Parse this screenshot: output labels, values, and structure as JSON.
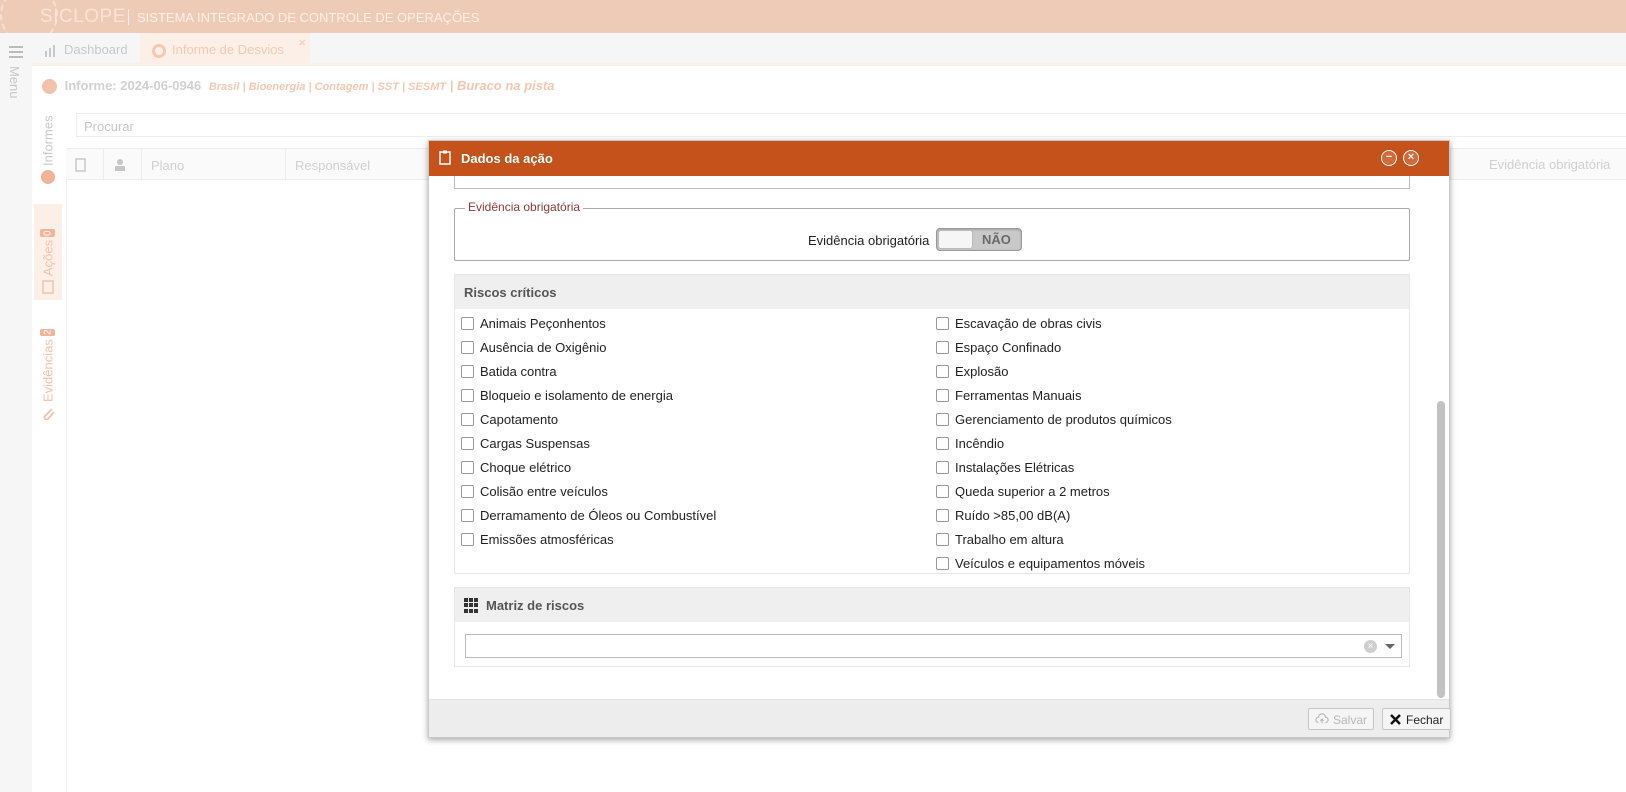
{
  "topbar": {
    "logo": "SICLOPE",
    "subtitle": "SISTEMA INTEGRADO DE CONTROLE DE OPERAÇÕES"
  },
  "rail": {
    "menu_label": "Menu"
  },
  "tabs": [
    {
      "label": "Dashboard",
      "icon": "chart-icon"
    },
    {
      "label": "Informe de Desvios",
      "icon": "whatsapp-icon",
      "close": "×"
    }
  ],
  "side_tabs": {
    "informes": {
      "label": "Informes"
    },
    "acoes": {
      "label": "Ações",
      "badge": "0"
    },
    "evidencias": {
      "label": "Evidências",
      "badge": "2"
    }
  },
  "informe": {
    "id": "Informe: 2024-06-0946",
    "crumbs": "Brasil | Bioenergia | Contagem | SST | SESMT",
    "title": "| Buraco na pista"
  },
  "search": {
    "placeholder": "Procurar"
  },
  "grid": {
    "columns": [
      "Plano",
      "Responsável"
    ],
    "right_column": "Evidência obrigatória"
  },
  "modal": {
    "title": "Dados da ação",
    "evidencia_legend": "Evidência obrigatória",
    "evidencia_label": "Evidência obrigatória",
    "toggle_value": "NÃO",
    "riscos_title": "Riscos críticos",
    "riscos_left": [
      "Animais Peçonhentos",
      "Ausência de Oxigênio",
      "Batida contra",
      "Bloqueio e isolamento de energia",
      "Capotamento",
      "Cargas Suspensas",
      "Choque elétrico",
      "Colisão entre veículos",
      "Derramamento de Óleos ou Combustível",
      "Emissões atmosféricas"
    ],
    "riscos_right": [
      "Escavação de obras civis",
      "Espaço Confinado",
      "Explosão",
      "Ferramentas Manuais",
      "Gerenciamento de produtos químicos",
      "Incêndio",
      "Instalações Elétricas",
      "Queda superior a 2 metros",
      "Ruído >85,00 dB(A)",
      "Trabalho em altura",
      "Veículos e equipamentos móveis"
    ],
    "matriz_title": "Matriz de riscos",
    "salvar": "Salvar",
    "fechar": "Fechar"
  },
  "colors": {
    "accent": "#c5521a",
    "topbar": "#eecbb7"
  }
}
